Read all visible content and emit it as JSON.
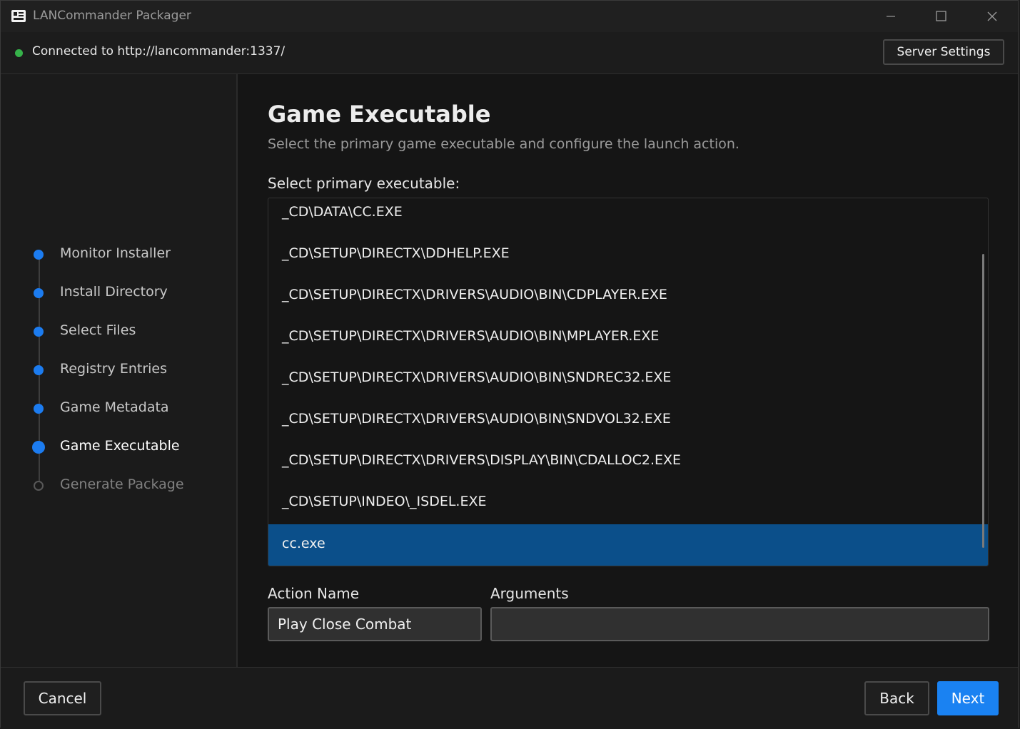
{
  "window": {
    "title": "LANCommander Packager",
    "controls": {
      "minimize_icon": "minimize-icon",
      "maximize_icon": "maximize-icon",
      "close_icon": "close-icon"
    }
  },
  "connection": {
    "status_color": "#36b24a",
    "text": "Connected to http://lancommander:1337/",
    "server_settings_label": "Server Settings"
  },
  "steps": [
    {
      "label": "Monitor Installer",
      "state": "done"
    },
    {
      "label": "Install Directory",
      "state": "done"
    },
    {
      "label": "Select Files",
      "state": "done"
    },
    {
      "label": "Registry Entries",
      "state": "done"
    },
    {
      "label": "Game Metadata",
      "state": "done"
    },
    {
      "label": "Game Executable",
      "state": "active"
    },
    {
      "label": "Generate Package",
      "state": "pending"
    }
  ],
  "page": {
    "title": "Game Executable",
    "subtitle": "Select the primary game executable and configure the launch action.",
    "list_label": "Select primary executable:",
    "executables": [
      "_CD\\DATA\\CC.EXE",
      "_CD\\SETUP\\DIRECTX\\DDHELP.EXE",
      "_CD\\SETUP\\DIRECTX\\DRIVERS\\AUDIO\\BIN\\CDPLAYER.EXE",
      "_CD\\SETUP\\DIRECTX\\DRIVERS\\AUDIO\\BIN\\MPLAYER.EXE",
      "_CD\\SETUP\\DIRECTX\\DRIVERS\\AUDIO\\BIN\\SNDREC32.EXE",
      "_CD\\SETUP\\DIRECTX\\DRIVERS\\AUDIO\\BIN\\SNDVOL32.EXE",
      "_CD\\SETUP\\DIRECTX\\DRIVERS\\DISPLAY\\BIN\\CDALLOC2.EXE",
      "_CD\\SETUP\\INDEO\\_ISDEL.EXE",
      "cc.exe"
    ],
    "selected_executable": "cc.exe",
    "action_name_label": "Action Name",
    "action_name_value": "Play Close Combat",
    "arguments_label": "Arguments",
    "arguments_value": ""
  },
  "footer": {
    "cancel_label": "Cancel",
    "back_label": "Back",
    "next_label": "Next"
  },
  "colors": {
    "accent": "#1a82f2",
    "selection": "#0b4f8a",
    "step_done": "#1c7cf0"
  }
}
